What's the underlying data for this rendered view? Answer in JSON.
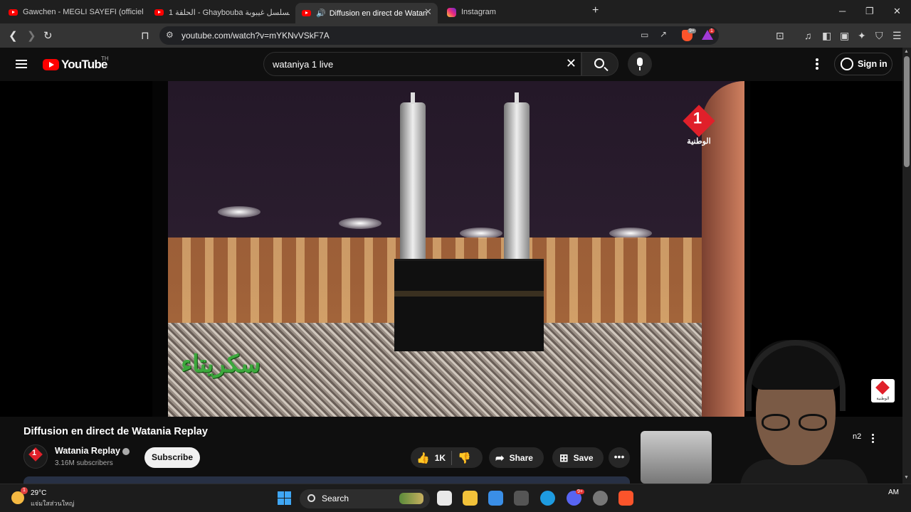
{
  "browser": {
    "tabs": [
      {
        "label": "Gawchen - MEGLI SAYEFI (officiel vid"
      },
      {
        "label": "الحلقة 1 - Ghaybouba مسلسل غيبوبة"
      },
      {
        "label": "Diffusion en direct de Watan"
      },
      {
        "label": "Instagram"
      }
    ],
    "new_tab_label": "+",
    "url": "youtube.com/watch?v=mYKNvVSkF7A",
    "notifications_badge": "1",
    "shields_badge": "9+"
  },
  "youtube": {
    "logo_text": "YouTube",
    "region": "TH",
    "search_query": "wataniya 1 live",
    "sign_in": "Sign in"
  },
  "video": {
    "channel_bug_number": "1",
    "channel_bug_name": "الوطنية",
    "watermark_text": "الوطنية",
    "onscreen_caption": "سكريتاء",
    "title": "Diffusion en direct de Watania Replay",
    "channel": "Watania Replay",
    "channel_avatar_text": "1",
    "subscribers": "3.16M subscribers",
    "subscribe_label": "Subscribe",
    "likes": "1K",
    "share_label": "Share",
    "save_label": "Save"
  },
  "sidebar": {
    "partial_text": "n2"
  },
  "taskbar": {
    "weather_badge": "1",
    "temperature": "29°C",
    "weather_desc": "แจ่มใสส่วนใหญ่",
    "search_label": "Search",
    "clock_partial": "AM",
    "discord_badge": "9+"
  },
  "colors": {
    "youtube_red": "#ff0000",
    "watania_red": "#e0202a",
    "background": "#0f0f0f"
  }
}
